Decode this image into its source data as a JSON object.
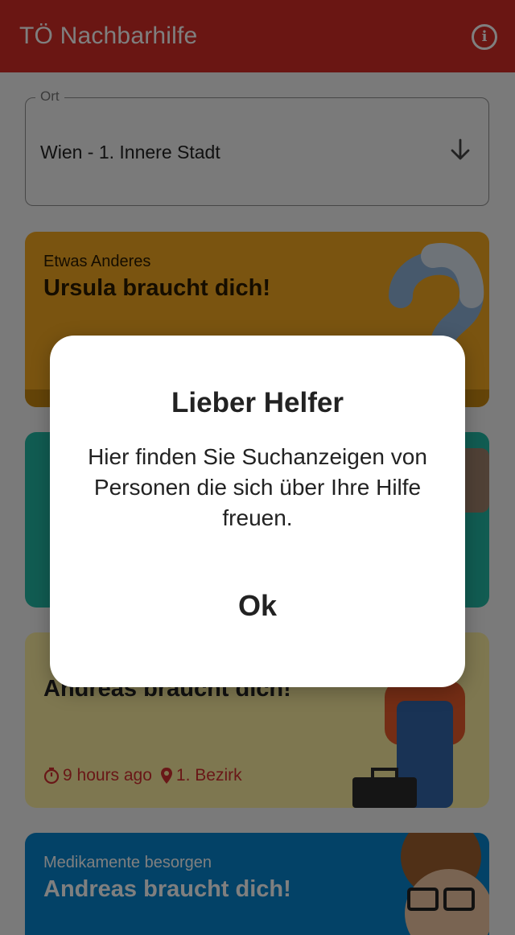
{
  "appbar": {
    "title": "TÖ Nachbarhilfe",
    "info_icon": "info-icon",
    "color": "#d42c26"
  },
  "location": {
    "legend": "Ort",
    "value": "Wien - 1. Innere Stadt",
    "arrow_icon": "arrow-down-icon"
  },
  "cards": [
    {
      "category": "Etwas Anderes",
      "headline": "Ursula braucht dich!",
      "color": "#f5a821"
    },
    {
      "color": "#23b9a4"
    },
    {
      "headline": "Andreas braucht dich!",
      "time": "9 hours ago",
      "district": "1. Bezirk",
      "color": "#fdeea0"
    },
    {
      "category": "Medikamente besorgen",
      "headline": "Andreas braucht dich!",
      "color": "#0784ce"
    }
  ],
  "dialog": {
    "title": "Lieber Helfer",
    "message": "Hier finden Sie Suchanzeigen von Personen die sich über Ihre Hilfe freuen.",
    "ok_label": "Ok"
  }
}
